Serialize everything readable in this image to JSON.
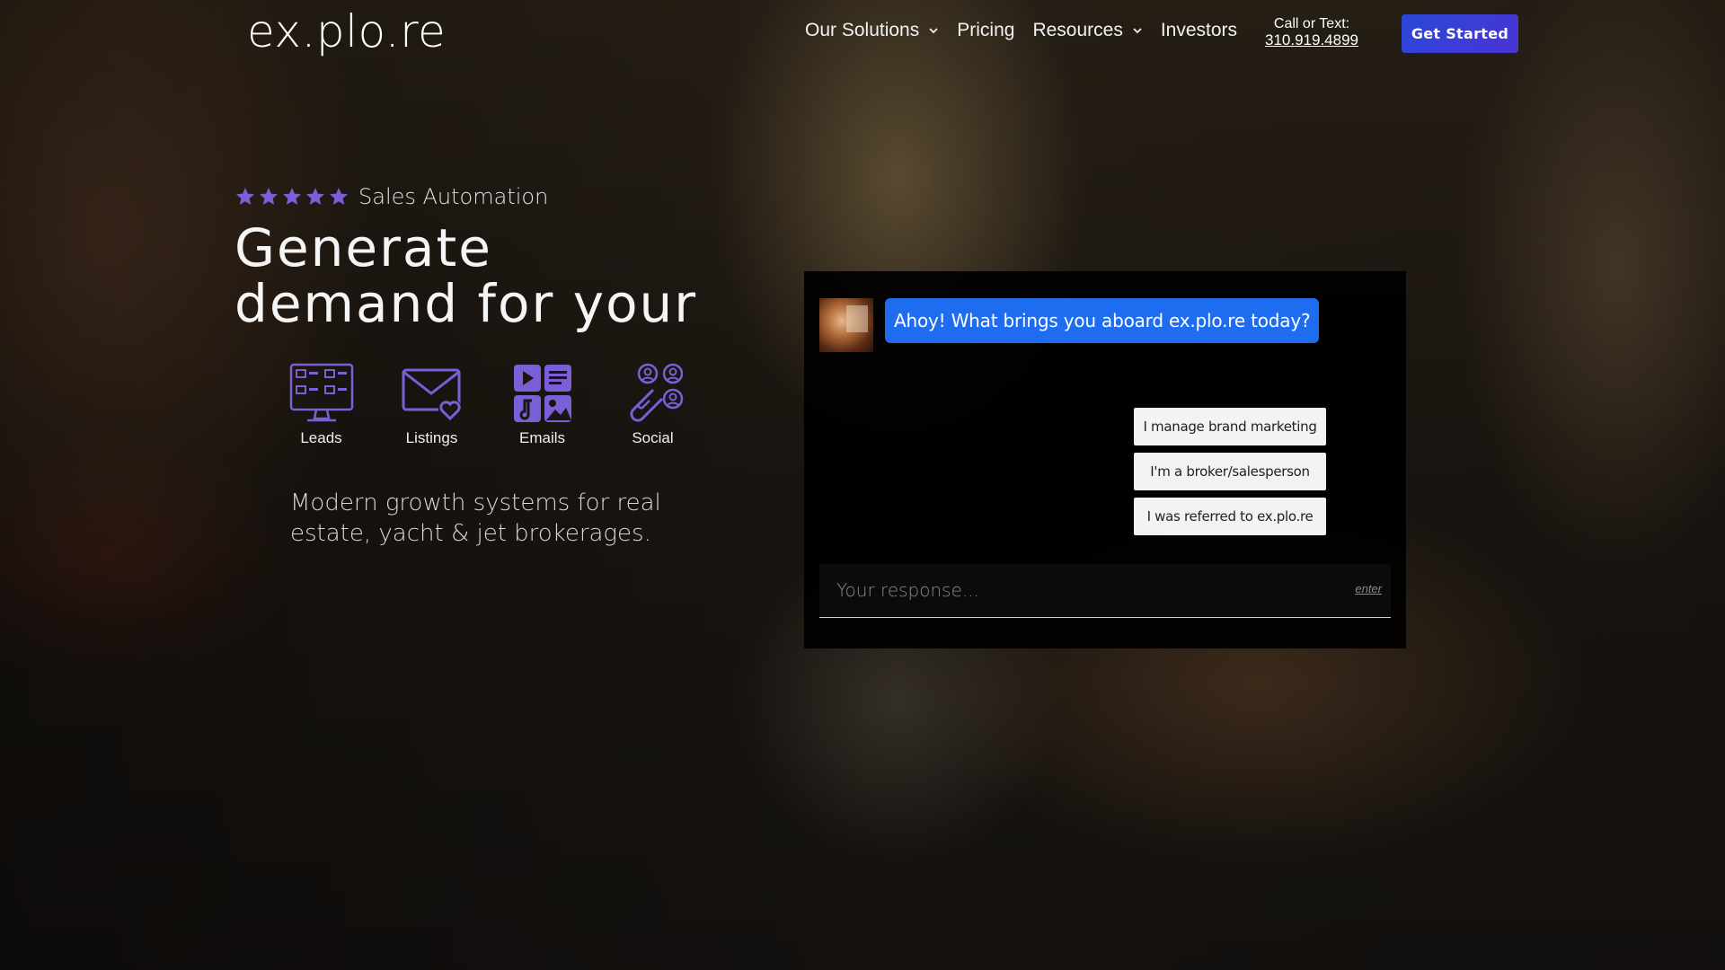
{
  "nav": {
    "logo": "ex.plo.re",
    "items": [
      {
        "label": "Our Solutions",
        "has_dropdown": true
      },
      {
        "label": "Pricing",
        "has_dropdown": false
      },
      {
        "label": "Resources",
        "has_dropdown": true
      },
      {
        "label": "Investors",
        "has_dropdown": false
      }
    ],
    "call_label": "Call or Text:",
    "phone": "310.919.4899",
    "cta_label": "Get Started"
  },
  "hero": {
    "rating_stars": 5,
    "rating_label": "Sales Automation",
    "headline": "Generate demand for your",
    "features": [
      {
        "label": "Leads",
        "icon": "monitor-apps-icon"
      },
      {
        "label": "Listings",
        "icon": "envelope-heart-icon"
      },
      {
        "label": "Emails",
        "icon": "media-grid-icon"
      },
      {
        "label": "Social",
        "icon": "magnet-users-icon"
      }
    ],
    "tagline": "Modern growth systems for real estate, yacht & jet brokerages."
  },
  "chat": {
    "greeting": "Ahoy! What brings you aboard ex.plo.re today?",
    "options": [
      "I manage brand marketing",
      "I'm a broker/salesperson",
      "I was referred to ex.plo.re"
    ],
    "input_placeholder": "Your response...",
    "enter_hint": "enter"
  },
  "colors": {
    "accent_purple": "#7a5fd6",
    "bubble_blue": "#1e6cf0",
    "cta_blue": "#2a48d8"
  }
}
